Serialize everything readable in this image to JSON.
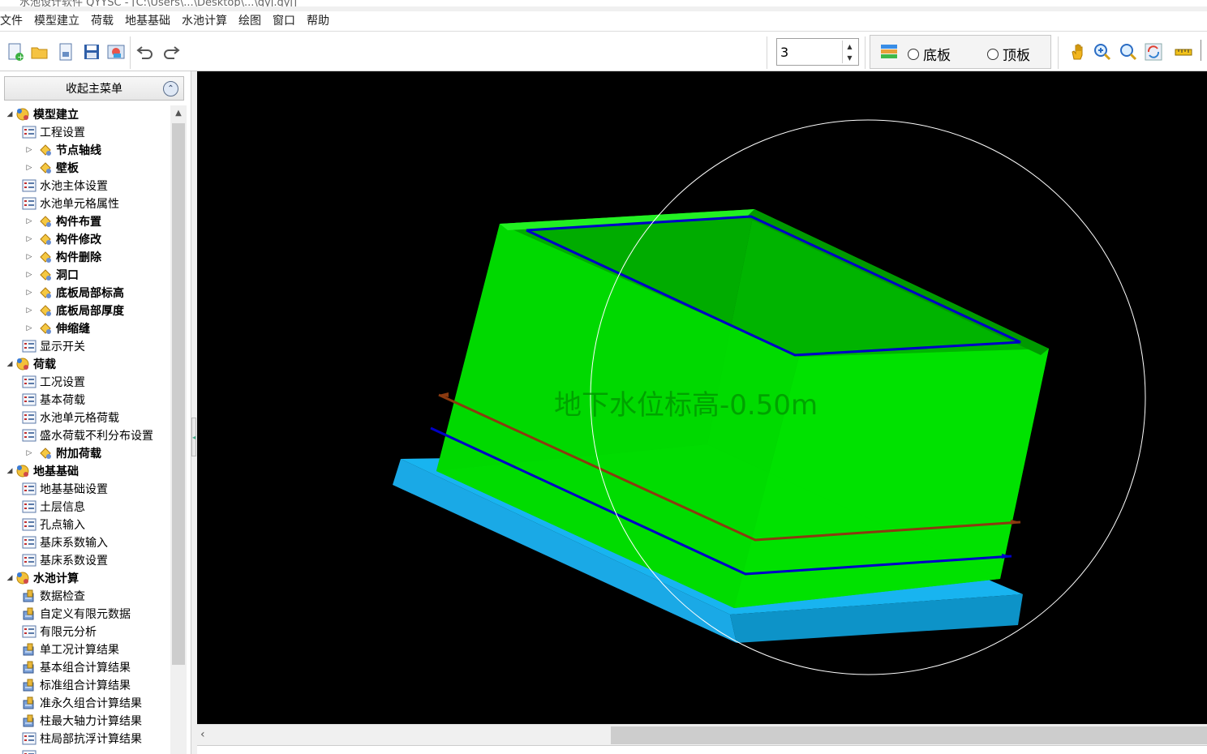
{
  "window": {
    "title": "水池设计软件 QYYSC - [C:\\Users\\...\\Desktop\\...\\qyj.qyj]"
  },
  "menu": [
    "文件",
    "模型建立",
    "荷载",
    "地基基础",
    "水池计算",
    "绘图",
    "窗口",
    "帮助"
  ],
  "toolbar": {
    "buttons": [
      "new-file-icon",
      "open-folder-icon",
      "page-icon",
      "save-icon",
      "image-icon",
      "undo-icon",
      "redo-icon"
    ],
    "floor_value": "3",
    "layer_options": [
      "底板",
      "顶板"
    ],
    "view_tools": [
      "pan-hand-icon",
      "zoom-in-icon",
      "zoom-window-icon",
      "refresh-view-icon",
      "measure-icon"
    ]
  },
  "sidebar": {
    "collapse_label": "收起主菜单",
    "tree": [
      {
        "label": "模型建立",
        "level": 0,
        "type": "group",
        "expanded": true
      },
      {
        "label": "工程设置",
        "level": 1,
        "type": "item"
      },
      {
        "label": "节点轴线",
        "level": 1,
        "type": "folder"
      },
      {
        "label": "壁板",
        "level": 1,
        "type": "folder"
      },
      {
        "label": "水池主体设置",
        "level": 1,
        "type": "item"
      },
      {
        "label": "水池单元格属性",
        "level": 1,
        "type": "item"
      },
      {
        "label": "构件布置",
        "level": 1,
        "type": "folder"
      },
      {
        "label": "构件修改",
        "level": 1,
        "type": "folder"
      },
      {
        "label": "构件删除",
        "level": 1,
        "type": "folder"
      },
      {
        "label": "洞口",
        "level": 1,
        "type": "folder"
      },
      {
        "label": "底板局部标高",
        "level": 1,
        "type": "folder"
      },
      {
        "label": "底板局部厚度",
        "level": 1,
        "type": "folder"
      },
      {
        "label": "伸缩缝",
        "level": 1,
        "type": "folder"
      },
      {
        "label": "显示开关",
        "level": 1,
        "type": "item"
      },
      {
        "label": "荷载",
        "level": 0,
        "type": "group",
        "expanded": true
      },
      {
        "label": "工况设置",
        "level": 1,
        "type": "item"
      },
      {
        "label": "基本荷载",
        "level": 1,
        "type": "item"
      },
      {
        "label": "水池单元格荷载",
        "level": 1,
        "type": "item"
      },
      {
        "label": "盛水荷载不利分布设置",
        "level": 1,
        "type": "item"
      },
      {
        "label": "附加荷载",
        "level": 1,
        "type": "folder"
      },
      {
        "label": "地基基础",
        "level": 0,
        "type": "group",
        "expanded": true
      },
      {
        "label": "地基基础设置",
        "level": 1,
        "type": "item"
      },
      {
        "label": "土层信息",
        "level": 1,
        "type": "item"
      },
      {
        "label": "孔点输入",
        "level": 1,
        "type": "item"
      },
      {
        "label": "基床系数输入",
        "level": 1,
        "type": "item"
      },
      {
        "label": "基床系数设置",
        "level": 1,
        "type": "item"
      },
      {
        "label": "水池计算",
        "level": 0,
        "type": "group",
        "expanded": true
      },
      {
        "label": "数据检查",
        "level": 1,
        "type": "calc"
      },
      {
        "label": "自定义有限元数据",
        "level": 1,
        "type": "calc"
      },
      {
        "label": "有限元分析",
        "level": 1,
        "type": "item"
      },
      {
        "label": "单工况计算结果",
        "level": 1,
        "type": "calc"
      },
      {
        "label": "基本组合计算结果",
        "level": 1,
        "type": "calc"
      },
      {
        "label": "标准组合计算结果",
        "level": 1,
        "type": "calc"
      },
      {
        "label": "准永久组合计算结果",
        "level": 1,
        "type": "calc"
      },
      {
        "label": "柱最大轴力计算结果",
        "level": 1,
        "type": "calc"
      },
      {
        "label": "柱局部抗浮计算结果",
        "level": 1,
        "type": "item"
      },
      {
        "label": "...",
        "level": 1,
        "type": "item"
      }
    ]
  },
  "viewport": {
    "overlay_text": "地下水位标高-0.50m",
    "colors": {
      "background": "#000000",
      "wall": "#00e400",
      "slab": "#10b8f0",
      "groundwater_line": "#8b3a10",
      "level_line": "#0000c8",
      "orbit_circle": "#ffffff"
    }
  }
}
